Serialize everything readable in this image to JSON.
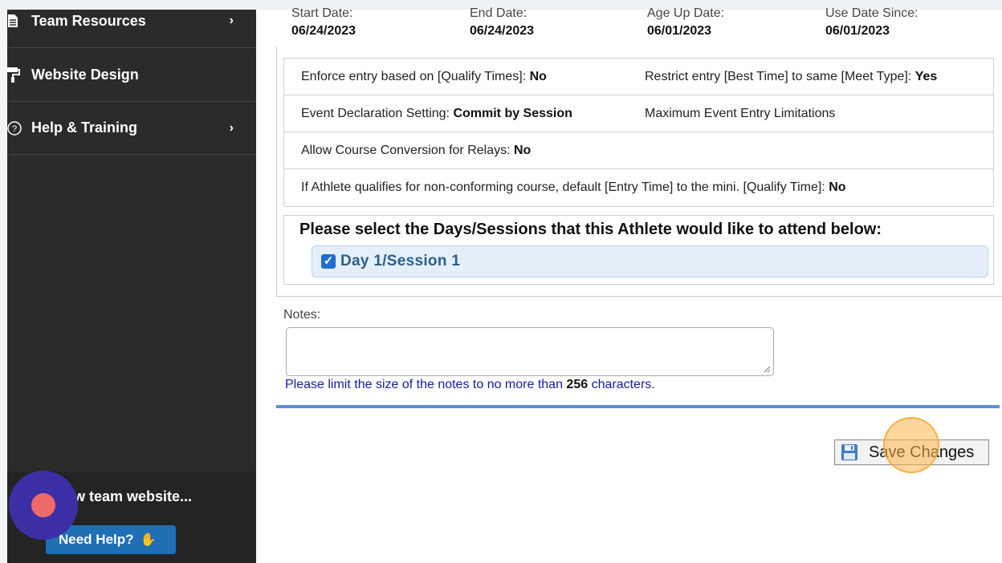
{
  "sidebar": {
    "items": [
      {
        "label": "Team Resources",
        "icon": "document-icon",
        "chevron": "›"
      },
      {
        "label": "Website Design",
        "icon": "paint-roller-icon",
        "chevron": ""
      },
      {
        "label": "Help & Training",
        "icon": "question-circle-icon",
        "chevron": "›"
      }
    ],
    "view_site_label": "ew team website...",
    "need_help_label": "Need Help?",
    "need_help_icon": "✋"
  },
  "dates": {
    "start_label": "Start Date:",
    "start_value": "06/24/2023",
    "end_label": "End Date:",
    "end_value": "06/24/2023",
    "age_up_label": "Age Up Date:",
    "age_up_value": "06/01/2023",
    "use_since_label": "Use Date Since:",
    "use_since_value": "06/01/2023"
  },
  "options": {
    "row1_left_text": "Enforce entry based on [Qualify Times]: ",
    "row1_left_value": "No",
    "row1_right_text": "Restrict entry [Best Time] to same [Meet Type]: ",
    "row1_right_value": "Yes",
    "row2_left_text": "Event Declaration Setting: ",
    "row2_left_value": "Commit by Session",
    "row2_right_text": "Maximum Event Entry Limitations",
    "row3_text": "Allow Course Conversion for Relays: ",
    "row3_value": "No",
    "row4_text": "If Athlete qualifies for non-conforming course, default [Entry Time] to the mini. [Qualify Time]: ",
    "row4_value": "No"
  },
  "sessions": {
    "title": "Please select the Days/Sessions that this Athlete would like to attend below:",
    "items": [
      {
        "label": "Day 1/Session 1",
        "checked": true
      }
    ]
  },
  "notes": {
    "label": "Notes:",
    "value": "",
    "hint_prefix": "Please limit the size of the notes to no more than ",
    "hint_number": "256",
    "hint_suffix": " characters."
  },
  "actions": {
    "save_label": "Save Changes"
  },
  "colors": {
    "sidebar_bg": "#2b2b2b",
    "accent_blue": "#5b8fd9",
    "need_help_bg": "#1f6fb5",
    "record_button": "#3c2fa6",
    "highlight": "#ffb74d"
  }
}
